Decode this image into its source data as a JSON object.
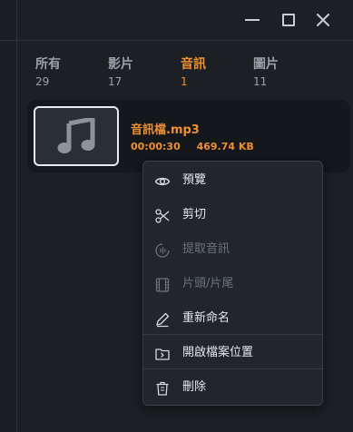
{
  "tabs": [
    {
      "label": "所有",
      "count": "29",
      "active": false
    },
    {
      "label": "影片",
      "count": "17",
      "active": false
    },
    {
      "label": "音訊",
      "count": "1",
      "active": true
    },
    {
      "label": "圖片",
      "count": "11",
      "active": false
    }
  ],
  "file": {
    "name": "音訊檔.mp3",
    "duration": "00:00:30",
    "size": "469.74 KB",
    "icon": "music-note-icon"
  },
  "context_menu": {
    "items": [
      {
        "label": "預覽",
        "icon": "eye-icon",
        "enabled": true
      },
      {
        "label": "剪切",
        "icon": "scissors-icon",
        "enabled": true
      },
      {
        "label": "提取音訊",
        "icon": "audio-extract-icon",
        "enabled": false
      },
      {
        "label": "片頭/片尾",
        "icon": "film-icon",
        "enabled": false
      },
      {
        "label": "重新命名",
        "icon": "pen-icon",
        "enabled": true
      },
      {
        "label": "開啟檔案位置",
        "icon": "folder-icon",
        "enabled": true
      },
      {
        "label": "刪除",
        "icon": "trash-icon",
        "enabled": true
      }
    ]
  },
  "colors": {
    "accent": "#f0902a",
    "background": "#1c1f24",
    "menu_bg": "#22262c",
    "text_disabled": "#6b717a"
  }
}
